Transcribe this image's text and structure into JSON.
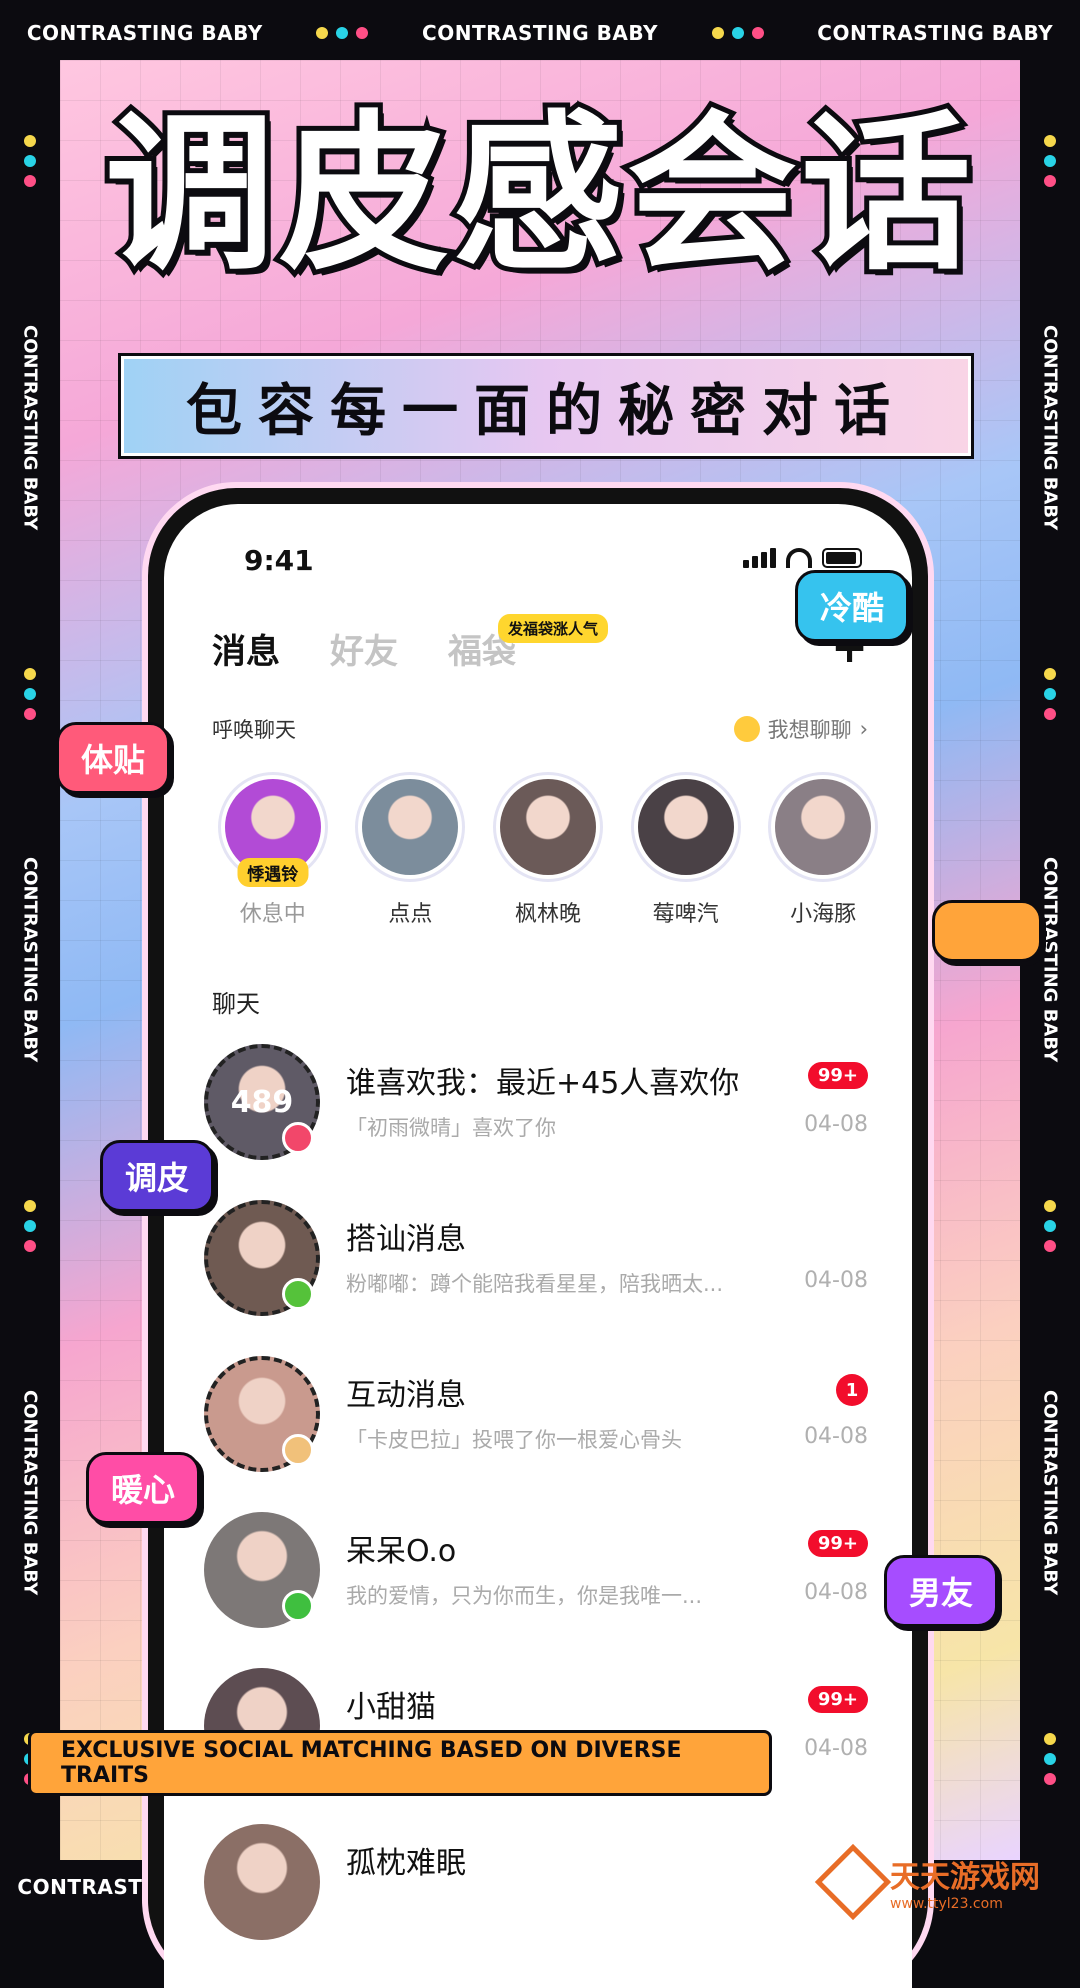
{
  "frame": {
    "repeat_text": "CONTRASTING BABY"
  },
  "headline": "调皮感会话",
  "subheadline": "包容每一面的秘密对话",
  "status_bar": {
    "time": "9:41"
  },
  "tabs": [
    {
      "label": "消息",
      "active": true
    },
    {
      "label": "好友",
      "active": false
    },
    {
      "label": "福袋",
      "active": false
    }
  ],
  "tab_badge": "发福袋涨人气",
  "plus_label": "+",
  "summon": {
    "title": "呼唤聊天",
    "want_chat": "我想聊聊",
    "chevron": "›"
  },
  "stories": [
    {
      "name": "休息中",
      "tag": "悸遇铃",
      "muted": true,
      "color": "#b24bd6"
    },
    {
      "name": "点点",
      "color": "#7c8d9c"
    },
    {
      "name": "枫林晚",
      "color": "#6b5a58"
    },
    {
      "name": "莓啤汽",
      "color": "#4a4146"
    },
    {
      "name": "小海豚",
      "color": "#8a7f86"
    }
  ],
  "chat_section_title": "聊天",
  "chats": [
    {
      "name": "谁喜欢我：最近+45人喜欢你",
      "preview": "「初雨微晴」喜欢了你",
      "date": "04-08",
      "unread": "99+",
      "avatar_count": "489",
      "avatar_color": "#5f5a66",
      "badge_color": "#f2476a",
      "dashed": true
    },
    {
      "name": "搭讪消息",
      "preview": "粉嘟嘟：蹲个能陪我看星星，陪我晒太...",
      "date": "04-08",
      "unread": "",
      "avatar_color": "#6f5a52",
      "badge_color": "#55c23a",
      "dashed": true
    },
    {
      "name": "互动消息",
      "preview": "「卡皮巴拉」投喂了你一根爱心骨头",
      "date": "04-08",
      "unread": "1",
      "avatar_color": "#c99a8e",
      "badge_color": "#f1c17a",
      "dashed": true
    },
    {
      "name": "呆呆O.o",
      "preview": "我的爱情，只为你而生，你是我唯一...",
      "date": "04-08",
      "unread": "99+",
      "avatar_color": "#7d7877",
      "badge_color": "#3fbf3f",
      "dashed": false
    },
    {
      "name": "小甜猫",
      "preview": "",
      "date": "04-08",
      "unread": "99+",
      "avatar_color": "#5d4d52",
      "badge_color": "",
      "dashed": false
    },
    {
      "name": "孤枕难眠",
      "preview": "",
      "date": "",
      "unread": "",
      "avatar_color": "#8b6f66",
      "badge_color": "",
      "dashed": false
    }
  ],
  "float_tags": [
    {
      "label": "冷酷",
      "color": "#36c3ee"
    },
    {
      "label": "体贴",
      "color": "#ff5a7a"
    },
    {
      "label": "调皮",
      "color": "#5b3bd6"
    },
    {
      "label": "暖心",
      "color": "#ff4da6"
    },
    {
      "label": "男友",
      "color": "#a64dff"
    }
  ],
  "bottom_bar": "EXCLUSIVE SOCIAL MATCHING BASED ON DIVERSE TRAITS",
  "watermark": {
    "title": "天天游戏网",
    "url": "www.ttyl23.com"
  }
}
